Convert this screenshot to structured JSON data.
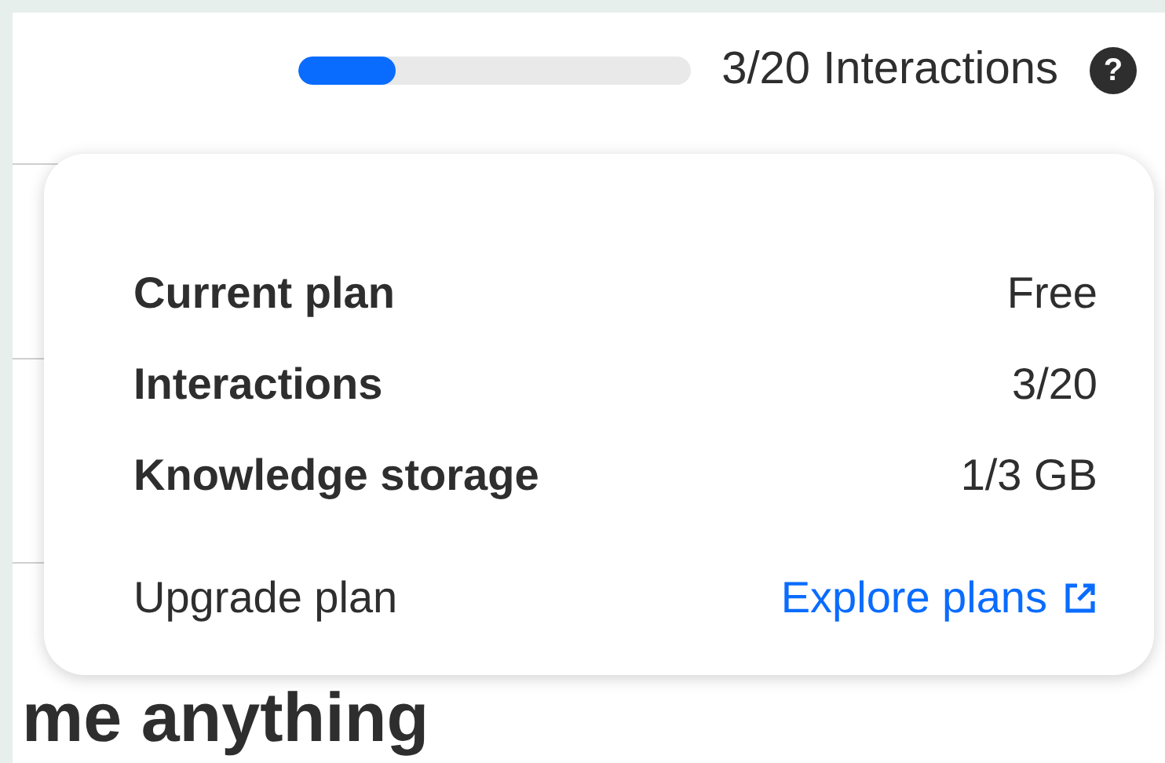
{
  "usage": {
    "level": 0.25,
    "label": "3/20 Interactions",
    "help_icon": "?"
  },
  "plan_popover": {
    "rows": [
      {
        "label": "Current plan",
        "value": "Free"
      },
      {
        "label": "Interactions",
        "value": "3/20"
      },
      {
        "label": "Knowledge storage",
        "value": "1/3 GB"
      }
    ],
    "upgrade": {
      "label": "Upgrade plan",
      "link": "Explore plans"
    }
  },
  "heading": "me anything"
}
